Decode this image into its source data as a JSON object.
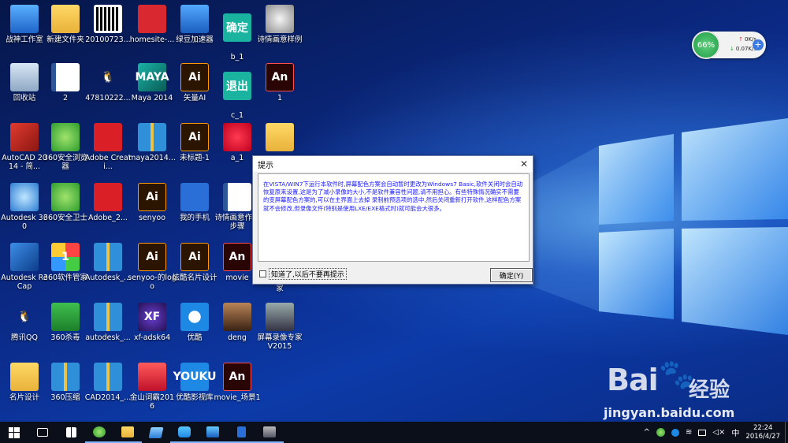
{
  "desktop_icons": [
    {
      "label": "战神工作室",
      "icon": "this-pc-icon"
    },
    {
      "label": "新建文件夹",
      "icon": "folder-icon"
    },
    {
      "label": "20100723...",
      "icon": "qr-image-icon"
    },
    {
      "label": "homesite-...",
      "icon": "homesite-icon"
    },
    {
      "label": "绿豆加速器",
      "icon": "frog-app-icon"
    },
    {
      "label": "b_1",
      "icon": "image-badge-icon",
      "badge": "确定"
    },
    {
      "label": "诗情画意样例",
      "icon": "flash-icon"
    },
    {
      "label": "回收站",
      "icon": "recycle-bin-icon"
    },
    {
      "label": "2",
      "icon": "word-doc-icon"
    },
    {
      "label": "47810222...",
      "icon": "qq-penguin-icon"
    },
    {
      "label": "Maya 2014",
      "icon": "maya-icon",
      "badge": "MAYA"
    },
    {
      "label": "矢量AI",
      "icon": "illustrator-icon",
      "badge": "Ai"
    },
    {
      "label": "c_1",
      "icon": "image-badge-icon",
      "badge": "退出"
    },
    {
      "label": "1",
      "icon": "animate-icon",
      "badge": "An"
    },
    {
      "label": "AutoCAD 2014 - 简...",
      "icon": "autocad-icon"
    },
    {
      "label": "360安全浏览器",
      "icon": "360-browser-icon"
    },
    {
      "label": "Adobe Creati...",
      "icon": "creative-cloud-icon"
    },
    {
      "label": "maya2014...",
      "icon": "archive-icon"
    },
    {
      "label": "未标题-1",
      "icon": "illustrator-icon",
      "badge": "Ai"
    },
    {
      "label": "a_1",
      "icon": "red-seal-icon"
    },
    {
      "label": "",
      "icon": "folder-icon"
    },
    {
      "label": "Autodesk 360",
      "icon": "autodesk360-icon"
    },
    {
      "label": "360安全卫士",
      "icon": "360-guard-icon"
    },
    {
      "label": "Adobe_2...",
      "icon": "adobe-icon"
    },
    {
      "label": "senyoo",
      "icon": "illustrator-icon",
      "badge": "Ai"
    },
    {
      "label": "我的手机",
      "icon": "phone-icon"
    },
    {
      "label": "诗情画意作业步骤",
      "icon": "word-doc-icon"
    },
    {
      "label": "Autodesk ReCap",
      "icon": "recap-icon"
    },
    {
      "label": "360软件管家",
      "icon": "software-manager-icon",
      "badge": "1"
    },
    {
      "label": "Autodesk_...",
      "icon": "archive-icon"
    },
    {
      "label": "senyoo-的logo",
      "icon": "illustrator-icon",
      "badge": "Ai"
    },
    {
      "label": "炫酷名片设计",
      "icon": "illustrator-icon",
      "badge": "Ai"
    },
    {
      "label": "movie",
      "icon": "animate-icon",
      "badge": "An"
    },
    {
      "label": "家",
      "icon": "folder-icon"
    },
    {
      "label": "腾讯QQ",
      "icon": "qq-penguin-icon"
    },
    {
      "label": "360杀毒",
      "icon": "360-antivirus-icon"
    },
    {
      "label": "autodesk_...",
      "icon": "archive-icon"
    },
    {
      "label": "xf-adsk64",
      "icon": "xf-keygen-icon",
      "badge": "XF"
    },
    {
      "label": "优酷",
      "icon": "youku-player-icon"
    },
    {
      "label": "deng",
      "icon": "photo-icon"
    },
    {
      "label": "屏幕录像专家V2015",
      "icon": "screen-recorder-icon"
    },
    {
      "label": "名片设计",
      "icon": "folder-icon"
    },
    {
      "label": "360压缩",
      "icon": "archive-icon"
    },
    {
      "label": "CAD2014_...",
      "icon": "archive-icon"
    },
    {
      "label": "金山词霸2016",
      "icon": "dictionary-icon"
    },
    {
      "label": "优酷影视库",
      "icon": "youku-library-icon",
      "badge": "YOUKU"
    },
    {
      "label": "movie_场景1",
      "icon": "animate-icon",
      "badge": "An"
    }
  ],
  "net_widget": {
    "percent": "66%",
    "upload": "0K/s",
    "download": "0.07K/s",
    "plus": "+"
  },
  "dialog": {
    "title": "提示",
    "close": "✕",
    "message": "在VISTA/WIN7下运行本软件时,屏幕配色方案会自动暂时更改为Windows7 Basic,软件关闭时会自动恢复原来设置,这是为了减小录像的大小,不是软件兼容性问题,请不用担心。有些特殊情况确实不需要的变屏幕配色方案的,可以在主界面上去掉 录制前预选项的选中,然后关闭重新打开软件,这样配色方案就不会修改,但录像文件(特别是使用LXE/EXE格式时)就可能会大很多。",
    "checkbox_label": "知道了,以后不要再提示",
    "ok_label": "确定(Y)"
  },
  "watermark": {
    "logo": "Bai",
    "paw": "🐾",
    "brand": "经验",
    "url": "jingyan.baidu.com"
  },
  "taskbar": {
    "start_icon": "windows-start-icon",
    "items": [
      "task-view-icon",
      "store-icon",
      "360-browser-icon",
      "file-explorer-icon",
      "notepad-icon",
      "frog-app-icon",
      "dictionary-icon",
      "phone-icon",
      "screen-recorder-icon"
    ],
    "tray": {
      "chevron": "^",
      "volume": "◁×",
      "ime": "中",
      "time": "22:24",
      "date": "2016/4/27"
    }
  }
}
